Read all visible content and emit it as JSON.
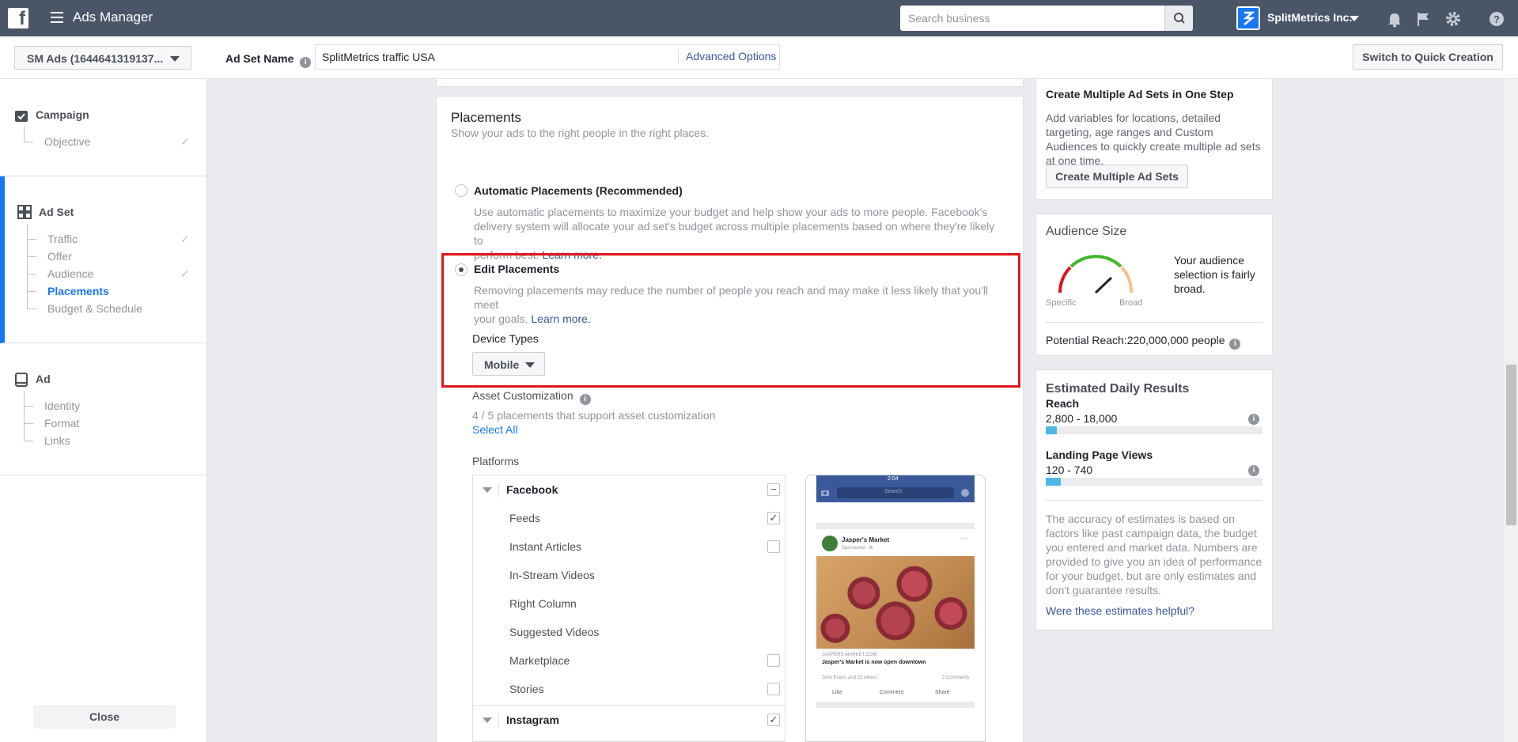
{
  "topbar": {
    "app_title": "Ads Manager",
    "search_placeholder": "Search business",
    "business_name": "SplitMetrics Inc.",
    "icons": [
      "facebook-logo",
      "menu-icon",
      "search-icon",
      "bell-icon",
      "flag-icon",
      "gear-icon",
      "help-icon"
    ]
  },
  "subbar": {
    "account": "SM Ads (1644641319137...",
    "adset_name_label": "Ad Set Name",
    "adset_name_value": "SplitMetrics traffic USA",
    "advanced_options": "Advanced Options",
    "switch_label": "Switch to Quick Creation"
  },
  "leftnav": {
    "campaign": {
      "title": "Campaign",
      "items": [
        "Objective"
      ]
    },
    "adset": {
      "title": "Ad Set",
      "items": [
        "Traffic",
        "Offer",
        "Audience",
        "Placements",
        "Budget & Schedule"
      ],
      "active": "Placements"
    },
    "ad": {
      "title": "Ad",
      "items": [
        "Identity",
        "Format",
        "Links"
      ]
    },
    "close": "Close"
  },
  "placements": {
    "title": "Placements",
    "subtitle": "Show your ads to the right people in the right places.",
    "auto": {
      "title": "Automatic Placements (Recommended)",
      "desc_1": "Use automatic placements to maximize your budget and help show your ads to more people. Facebook's",
      "desc_2": "delivery system will allocate your ad set's budget across multiple placements based on where they're likely to",
      "desc_3": "perform best.",
      "learn_more": "Learn more."
    },
    "edit": {
      "title": "Edit Placements",
      "desc_1": "Removing placements may reduce the number of people you reach and may make it less likely that you'll meet",
      "desc_2": "your goals.",
      "learn_more": "Learn more."
    },
    "device_types_label": "Device Types",
    "device_value": "Mobile",
    "asset_title": "Asset Customization",
    "asset_desc": "4 / 5 placements that support asset customization",
    "select_all": "Select All",
    "platforms_label": "Platforms",
    "facebook": {
      "label": "Facebook",
      "items": [
        {
          "label": "Feeds",
          "checked": true
        },
        {
          "label": "Instant Articles",
          "checked": false
        },
        {
          "label": "In-Stream Videos"
        },
        {
          "label": "Right Column"
        },
        {
          "label": "Suggested Videos"
        },
        {
          "label": "Marketplace",
          "checked": false
        },
        {
          "label": "Stories",
          "checked": false
        }
      ]
    },
    "instagram": {
      "label": "Instagram",
      "checked": true
    }
  },
  "preview": {
    "time": "2:04",
    "search": "Search",
    "page_name": "Jasper's Market",
    "sponsored": "Sponsored · ⚙",
    "domain": "JASPERS-MARKET.COM",
    "headline": "Jasper's Market is now open downtown",
    "reactions": "John Evans and 23 others",
    "comments": "2 Comments",
    "like": "Like",
    "comment": "Comment",
    "share": "Share"
  },
  "right": {
    "multi_title": "Create Multiple Ad Sets in One Step",
    "multi_desc": "Add variables for locations, detailed targeting, age ranges and Custom Audiences to quickly create multiple ad sets at one time.",
    "multi_button": "Create Multiple Ad Sets",
    "audience_title": "Audience Size",
    "gauge_left": "Specific",
    "gauge_right": "Broad",
    "audience_desc": "Your audience selection is fairly broad.",
    "potential_reach": "Potential Reach:220,000,000 people",
    "est_title": "Estimated Daily Results",
    "reach_label": "Reach",
    "reach_range": "2,800 - 18,000",
    "reach_fill": 0.05,
    "lpv_label": "Landing Page Views",
    "lpv_range": "120 - 740",
    "lpv_fill": 0.07,
    "est_desc": "The accuracy of estimates is based on factors like past campaign data, the budget you entered and market data. Numbers are provided to give you an idea of performance for your budget, but are only estimates and don't guarantee results.",
    "est_helpful": "Were these estimates helpful?"
  },
  "colors": {
    "topbar": "#4a5668",
    "accent": "#1877f2",
    "link": "#365899",
    "highlight": "#e0141c"
  }
}
